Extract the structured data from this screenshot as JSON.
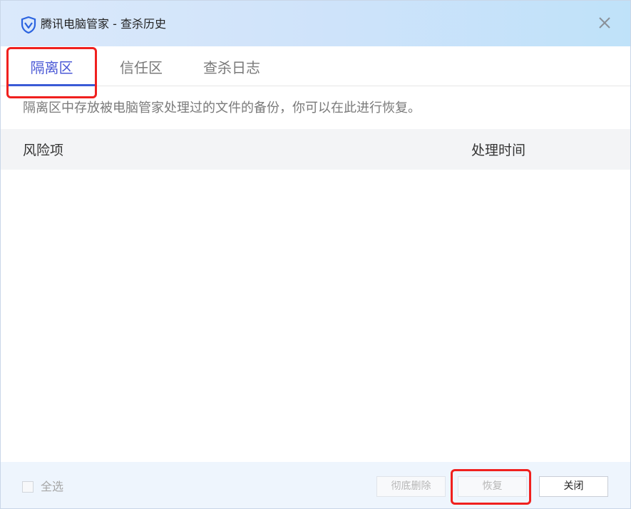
{
  "window": {
    "title": "腾讯电脑管家 - 查杀历史",
    "close_icon": "close-icon"
  },
  "tabs": [
    {
      "label": "隔离区",
      "active": true
    },
    {
      "label": "信任区",
      "active": false
    },
    {
      "label": "查杀日志",
      "active": false
    }
  ],
  "description": "隔离区中存放被电脑管家处理过的文件的备份，你可以在此进行恢复。",
  "table": {
    "columns": [
      "风险项",
      "处理时间"
    ],
    "rows": []
  },
  "footer": {
    "select_all_label": "全选",
    "select_all_checked": false,
    "delete_label": "彻底删除",
    "restore_label": "恢复",
    "close_label": "关闭"
  },
  "colors": {
    "accent": "#4b59d6",
    "highlight": "#f0201e",
    "titlebar": "#cfe3fa"
  }
}
